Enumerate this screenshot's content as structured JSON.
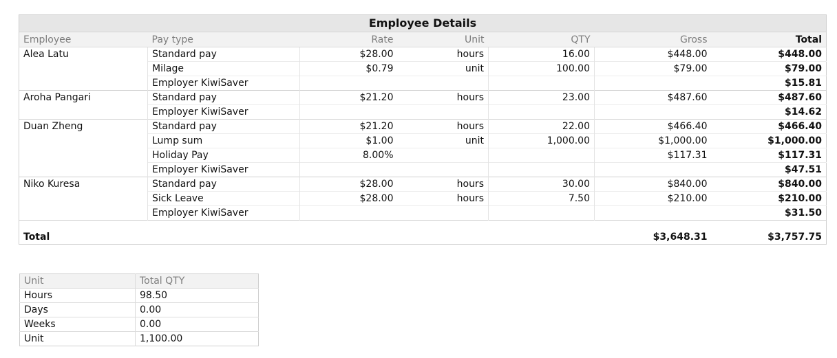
{
  "employee_details": {
    "title": "Employee Details",
    "columns": {
      "employee": "Employee",
      "pay_type": "Pay type",
      "rate": "Rate",
      "unit": "Unit",
      "qty": "QTY",
      "gross": "Gross",
      "total": "Total"
    },
    "groups": [
      {
        "employee": "Alea Latu",
        "lines": [
          {
            "pay_type": "Standard pay",
            "rate": "$28.00",
            "unit": "hours",
            "qty": "16.00",
            "gross": "$448.00",
            "total": "$448.00"
          },
          {
            "pay_type": "Milage",
            "rate": "$0.79",
            "unit": "unit",
            "qty": "100.00",
            "gross": "$79.00",
            "total": "$79.00"
          },
          {
            "pay_type": "Employer KiwiSaver",
            "rate": "",
            "unit": "",
            "qty": "",
            "gross": "",
            "total": "$15.81"
          }
        ]
      },
      {
        "employee": "Aroha Pangari",
        "lines": [
          {
            "pay_type": "Standard pay",
            "rate": "$21.20",
            "unit": "hours",
            "qty": "23.00",
            "gross": "$487.60",
            "total": "$487.60"
          },
          {
            "pay_type": "Employer KiwiSaver",
            "rate": "",
            "unit": "",
            "qty": "",
            "gross": "",
            "total": "$14.62"
          }
        ]
      },
      {
        "employee": "Duan Zheng",
        "lines": [
          {
            "pay_type": "Standard pay",
            "rate": "$21.20",
            "unit": "hours",
            "qty": "22.00",
            "gross": "$466.40",
            "total": "$466.40"
          },
          {
            "pay_type": "Lump sum",
            "rate": "$1.00",
            "unit": "unit",
            "qty": "1,000.00",
            "gross": "$1,000.00",
            "total": "$1,000.00"
          },
          {
            "pay_type": "Holiday Pay",
            "rate": "8.00%",
            "unit": "",
            "qty": "",
            "gross": "$117.31",
            "total": "$117.31"
          },
          {
            "pay_type": "Employer KiwiSaver",
            "rate": "",
            "unit": "",
            "qty": "",
            "gross": "",
            "total": "$47.51"
          }
        ]
      },
      {
        "employee": "Niko Kuresa",
        "lines": [
          {
            "pay_type": "Standard pay",
            "rate": "$28.00",
            "unit": "hours",
            "qty": "30.00",
            "gross": "$840.00",
            "total": "$840.00"
          },
          {
            "pay_type": "Sick Leave",
            "rate": "$28.00",
            "unit": "hours",
            "qty": "7.50",
            "gross": "$210.00",
            "total": "$210.00"
          },
          {
            "pay_type": "Employer KiwiSaver",
            "rate": "",
            "unit": "",
            "qty": "",
            "gross": "",
            "total": "$31.50"
          }
        ]
      }
    ],
    "totals": {
      "label": "Total",
      "gross": "$3,648.31",
      "total": "$3,757.75"
    }
  },
  "unit_summary": {
    "columns": {
      "unit": "Unit",
      "total_qty": "Total QTY"
    },
    "rows": [
      {
        "unit": "Hours",
        "total_qty": "98.50"
      },
      {
        "unit": "Days",
        "total_qty": "0.00"
      },
      {
        "unit": "Weeks",
        "total_qty": "0.00"
      },
      {
        "unit": "Unit",
        "total_qty": "1,100.00"
      }
    ]
  }
}
